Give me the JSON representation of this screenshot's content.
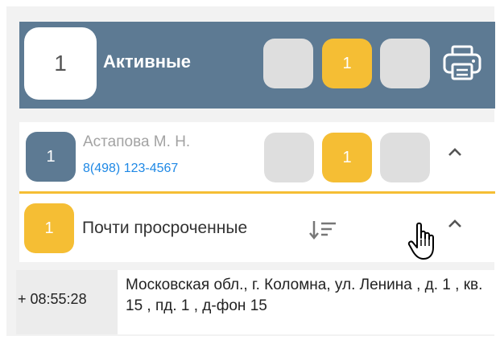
{
  "header": {
    "count": "1",
    "title": "Активные",
    "badges": [
      "",
      "1",
      ""
    ],
    "print_icon": "printer-icon"
  },
  "patient": {
    "badge": "1",
    "name": "Астапова М. Н.",
    "phone": "8(498) 123-4567",
    "badges": [
      "",
      "1",
      ""
    ],
    "collapse_icon": "chevron-up-icon"
  },
  "group": {
    "badge": "1",
    "title": "Почти просроченные",
    "sort_icon": "sort-descending-icon",
    "collapse_icon": "chevron-up-icon",
    "cursor_icon": "hand-pointer-icon"
  },
  "call": {
    "time": "+ 08:55:28",
    "address": "Московская обл., г. Коломна, ул. Ленина , д. 1 , кв. 15 , пд. 1 , д-фон 15"
  },
  "colors": {
    "header_bg": "#5d7a93",
    "accent_orange": "#f5be34",
    "grey_badge": "#dedede",
    "phone_link": "#1e88e5"
  }
}
